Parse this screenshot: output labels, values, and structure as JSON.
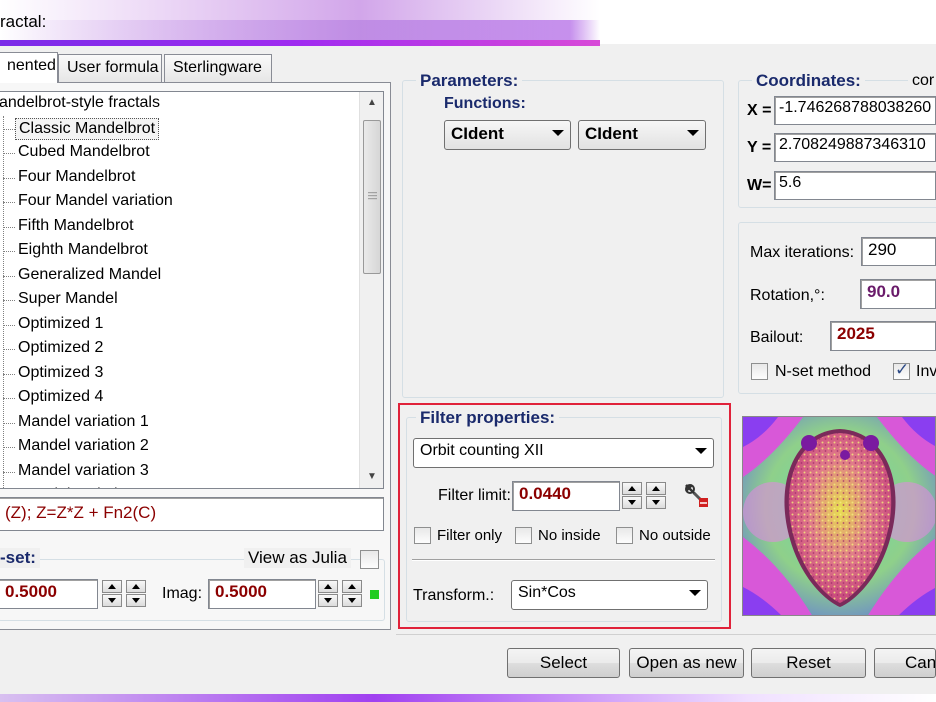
{
  "window": {
    "title": "ractal:"
  },
  "tabs": [
    {
      "label": "nented",
      "active": true
    },
    {
      "label": "User formula",
      "active": false
    },
    {
      "label": "Sterlingware",
      "active": false
    }
  ],
  "tree": {
    "root": "andelbrot-style fractals",
    "items": [
      "Classic Mandelbrot",
      "Cubed Mandelbrot",
      "Four Mandelbrot",
      "Four Mandel variation",
      "Fifth Mandelbrot",
      "Eighth Mandelbrot",
      "Generalized Mandel",
      "Super Mandel",
      "Optimized 1",
      "Optimized 2",
      "Optimized 3",
      "Optimized 4",
      "Mandel variation 1",
      "Mandel variation 2",
      "Mandel variation 3",
      "Mandel variation 4"
    ],
    "selected_index": 0
  },
  "formula": "(Z); Z=Z*Z + Fn2(C)",
  "nset": {
    "legend": "-set:",
    "view_as_julia_label": "View as Julia",
    "view_as_julia_checked": false,
    "real_value": "0.5000",
    "imag_label": "Imag:",
    "imag_value": "0.5000"
  },
  "parameters": {
    "legend": "Parameters:",
    "functions_label": "Functions:",
    "fn1": "CIdent",
    "fn2": "CIdent"
  },
  "filter": {
    "legend": "Filter properties:",
    "type": "Orbit counting XII",
    "limit_label": "Filter limit:",
    "limit_value": "0.0440",
    "filter_only_label": "Filter only",
    "no_inside_label": "No inside",
    "no_outside_label": "No outside",
    "transform_label": "Transform.:",
    "transform_value": "Sin*Cos"
  },
  "coordinates": {
    "legend": "Coordinates:",
    "legend_extra": "cor",
    "x_label": "X =",
    "x_value": "-1.746268788038260",
    "y_label": "Y =",
    "y_value": "2.708249887346310",
    "w_label": "W=",
    "w_value": "5.6"
  },
  "settings": {
    "max_iter_label": "Max iterations:",
    "max_iter_value": "290",
    "rotation_label": "Rotation,°:",
    "rotation_value": "90.0",
    "bailout_label": "Bailout:",
    "bailout_value": "2025",
    "nset_method_label": "N-set method",
    "nset_method_checked": false,
    "inv_label": "Inv",
    "inv_checked": true
  },
  "buttons": {
    "select": "Select",
    "open_as_new": "Open as new",
    "reset": "Reset",
    "cancel": "Can"
  },
  "colors": {
    "accent_red": "#e0223a",
    "legend_blue": "#1a2a6c",
    "value_dark_red": "#8b0000",
    "rotation_purple": "#6a1b6a",
    "indicator_green": "#22cc22"
  }
}
